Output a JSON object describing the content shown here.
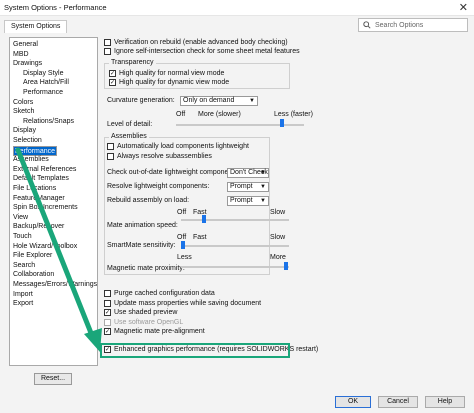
{
  "window": {
    "title": "System Options - Performance",
    "close_glyph": "✕"
  },
  "tab": {
    "label": "System Options"
  },
  "search": {
    "placeholder": "Search Options",
    "icon": "search-icon"
  },
  "tree": [
    "General",
    "MBD",
    "Drawings",
    "Display Style",
    "Area Hatch/Fill",
    "Performance",
    "Colors",
    "Sketch",
    "Relations/Snaps",
    "Display",
    "Selection",
    "Performance",
    "Assemblies",
    "External References",
    "Default Templates",
    "File Locations",
    "FeatureManager",
    "Spin Box Increments",
    "View",
    "Backup/Recover",
    "Touch",
    "Hole Wizard/Toolbox",
    "File Explorer",
    "Search",
    "Collaboration",
    "Messages/Errors/Warnings",
    "Import",
    "Export"
  ],
  "tree_selected_index": 11,
  "reset_label": "Reset...",
  "top_checks": [
    {
      "label": "Verification on rebuild (enable advanced body checking)",
      "checked": false
    },
    {
      "label": "Ignore self-intersection check for some sheet metal features",
      "checked": false
    }
  ],
  "transparency": {
    "legend": "Transparency",
    "checks": [
      {
        "label": "High quality for normal view mode",
        "checked": true
      },
      {
        "label": "High quality for dynamic view mode",
        "checked": true
      }
    ]
  },
  "curvature": {
    "label": "Curvature generation:",
    "value": "Only on demand"
  },
  "level_of_detail": {
    "label": "Level of detail:",
    "min": "Off",
    "mid": "More (slower)",
    "max": "Less (faster)",
    "value": 0.84
  },
  "assemblies": {
    "legend": "Assemblies",
    "checks": [
      {
        "label": "Automatically load components lightweight",
        "checked": false
      },
      {
        "label": "Always resolve subassemblies",
        "checked": false
      }
    ],
    "check_out_of_date": {
      "label": "Check out-of-date lightweight components:",
      "value": "Don't Check"
    },
    "resolve_lightweight": {
      "label": "Resolve lightweight components:",
      "value": "Prompt"
    },
    "rebuild_on_load": {
      "label": "Rebuild assembly on load:",
      "value": "Prompt"
    },
    "mate_animation": {
      "label": "Mate animation speed:",
      "min": "Off",
      "mid": "Fast",
      "max": "Slow",
      "value": 0.2
    },
    "smartmate": {
      "label": "SmartMate sensitivity:",
      "min": "Off",
      "mid": "Fast",
      "max": "Slow",
      "value": 0.0
    },
    "magnetic_proximity": {
      "label": "Magnetic mate proximity:",
      "min": "Less",
      "max": "More",
      "value": 0.99
    }
  },
  "bottom_checks": [
    {
      "label": "Purge cached configuration data",
      "checked": false,
      "disabled": false
    },
    {
      "label": "Update mass properties while saving document",
      "checked": false,
      "disabled": false
    },
    {
      "label": "Use shaded preview",
      "checked": true,
      "disabled": false
    },
    {
      "label": "Use software OpenGL",
      "checked": false,
      "disabled": true
    },
    {
      "label": "Magnetic mate pre-alignment",
      "checked": true,
      "disabled": false
    },
    {
      "label": "Enhanced graphics performance (requires SOLIDWORKS restart)",
      "checked": true,
      "disabled": false
    }
  ],
  "buttons": {
    "ok": "OK",
    "cancel": "Cancel",
    "help": "Help"
  },
  "colors": {
    "accent": "#0066cc",
    "highlight_box": "#1aa67a",
    "arrow": "#1aa67a"
  }
}
